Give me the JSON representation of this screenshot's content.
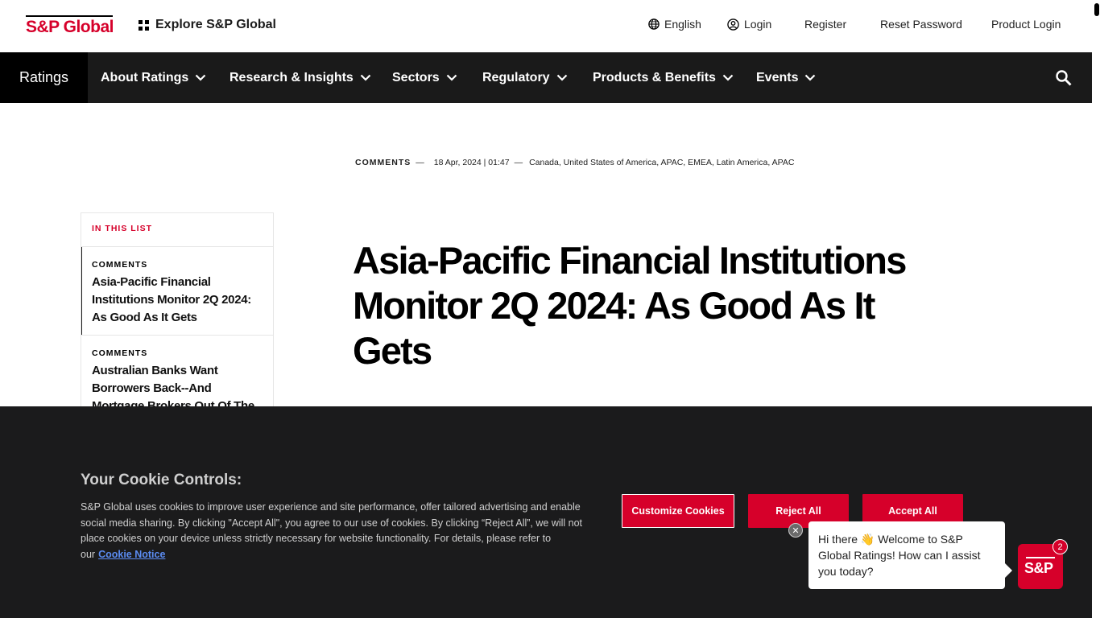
{
  "header": {
    "logo_text": "S&P Global",
    "explore_label": "Explore S&P Global",
    "language_label": "English",
    "login_label": "Login",
    "register_label": "Register",
    "reset_password_label": "Reset Password",
    "product_login_label": "Product Login"
  },
  "nav": {
    "section_label": "Ratings",
    "items": [
      {
        "label": "About Ratings"
      },
      {
        "label": "Research & Insights"
      },
      {
        "label": "Sectors"
      },
      {
        "label": "Regulatory"
      },
      {
        "label": "Products & Benefits"
      },
      {
        "label": "Events"
      }
    ],
    "search_icon": "search-icon"
  },
  "article": {
    "type": "COMMENTS",
    "separator": "—",
    "datetime": "18 Apr, 2024 | 01:47",
    "regions": "Canada, United States of America, APAC, EMEA, Latin America, APAC",
    "title": "Asia-Pacific Financial Institutions Monitor 2Q 2024: As Good As It Gets"
  },
  "sidebar": {
    "heading": "IN THIS LIST",
    "items": [
      {
        "type": "COMMENTS",
        "title": "Asia-Pacific Financial Institutions Monitor 2Q 2024: As Good As It Gets"
      },
      {
        "type": "COMMENTS",
        "title": "Australian Banks Want Borrowers Back--And Mortgage Brokers Out Of The"
      }
    ]
  },
  "cookie_banner": {
    "title": "Your Cookie Controls:",
    "text": "S&P Global uses cookies to improve user experience and site performance, offer tailored advertising and enable social media sharing. By clicking \"Accept All\", you agree to our use of cookies. By clicking “Reject All”, we will not place cookies on your device unless strictly necessary for website functionality. For details, please refer to our",
    "link_label": "Cookie Notice",
    "customize_label": "Customize Cookies",
    "reject_label": "Reject All",
    "accept_label": "Accept All"
  },
  "chat": {
    "close_label": "✕",
    "message": "Hi there 👋 Welcome to S&P Global Ratings! How can I assist you today?",
    "launcher_text": "S&P",
    "badge_count": "2"
  },
  "colors": {
    "brand_red": "#d6002a",
    "nav_bg": "#1a1a1a",
    "cookie_bg": "#1b1b1c",
    "link_blue": "#5b8cf2"
  }
}
